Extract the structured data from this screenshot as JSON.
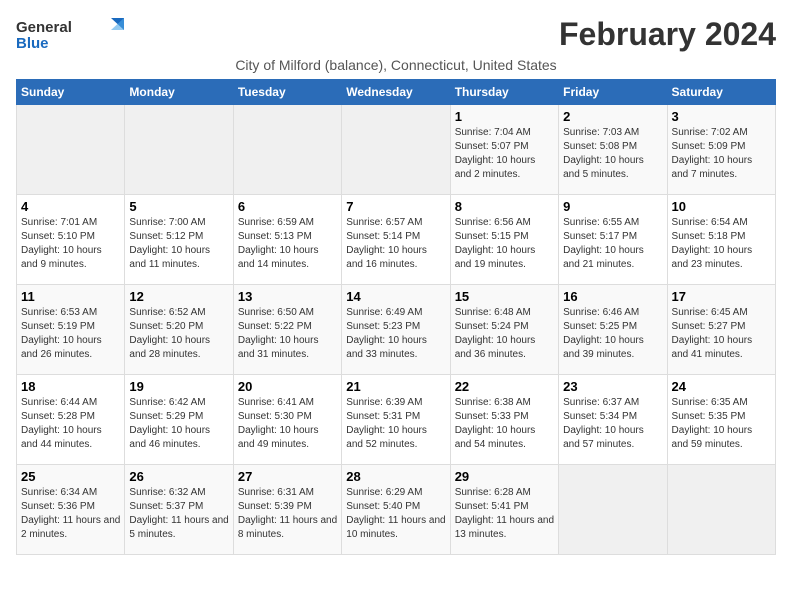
{
  "logo": {
    "general": "General",
    "blue": "Blue"
  },
  "title": "February 2024",
  "subtitle": "City of Milford (balance), Connecticut, United States",
  "days_of_week": [
    "Sunday",
    "Monday",
    "Tuesday",
    "Wednesday",
    "Thursday",
    "Friday",
    "Saturday"
  ],
  "weeks": [
    [
      {
        "day": "",
        "info": ""
      },
      {
        "day": "",
        "info": ""
      },
      {
        "day": "",
        "info": ""
      },
      {
        "day": "",
        "info": ""
      },
      {
        "day": "1",
        "info": "Sunrise: 7:04 AM\nSunset: 5:07 PM\nDaylight: 10 hours\nand 2 minutes."
      },
      {
        "day": "2",
        "info": "Sunrise: 7:03 AM\nSunset: 5:08 PM\nDaylight: 10 hours\nand 5 minutes."
      },
      {
        "day": "3",
        "info": "Sunrise: 7:02 AM\nSunset: 5:09 PM\nDaylight: 10 hours\nand 7 minutes."
      }
    ],
    [
      {
        "day": "4",
        "info": "Sunrise: 7:01 AM\nSunset: 5:10 PM\nDaylight: 10 hours\nand 9 minutes."
      },
      {
        "day": "5",
        "info": "Sunrise: 7:00 AM\nSunset: 5:12 PM\nDaylight: 10 hours\nand 11 minutes."
      },
      {
        "day": "6",
        "info": "Sunrise: 6:59 AM\nSunset: 5:13 PM\nDaylight: 10 hours\nand 14 minutes."
      },
      {
        "day": "7",
        "info": "Sunrise: 6:57 AM\nSunset: 5:14 PM\nDaylight: 10 hours\nand 16 minutes."
      },
      {
        "day": "8",
        "info": "Sunrise: 6:56 AM\nSunset: 5:15 PM\nDaylight: 10 hours\nand 19 minutes."
      },
      {
        "day": "9",
        "info": "Sunrise: 6:55 AM\nSunset: 5:17 PM\nDaylight: 10 hours\nand 21 minutes."
      },
      {
        "day": "10",
        "info": "Sunrise: 6:54 AM\nSunset: 5:18 PM\nDaylight: 10 hours\nand 23 minutes."
      }
    ],
    [
      {
        "day": "11",
        "info": "Sunrise: 6:53 AM\nSunset: 5:19 PM\nDaylight: 10 hours\nand 26 minutes."
      },
      {
        "day": "12",
        "info": "Sunrise: 6:52 AM\nSunset: 5:20 PM\nDaylight: 10 hours\nand 28 minutes."
      },
      {
        "day": "13",
        "info": "Sunrise: 6:50 AM\nSunset: 5:22 PM\nDaylight: 10 hours\nand 31 minutes."
      },
      {
        "day": "14",
        "info": "Sunrise: 6:49 AM\nSunset: 5:23 PM\nDaylight: 10 hours\nand 33 minutes."
      },
      {
        "day": "15",
        "info": "Sunrise: 6:48 AM\nSunset: 5:24 PM\nDaylight: 10 hours\nand 36 minutes."
      },
      {
        "day": "16",
        "info": "Sunrise: 6:46 AM\nSunset: 5:25 PM\nDaylight: 10 hours\nand 39 minutes."
      },
      {
        "day": "17",
        "info": "Sunrise: 6:45 AM\nSunset: 5:27 PM\nDaylight: 10 hours\nand 41 minutes."
      }
    ],
    [
      {
        "day": "18",
        "info": "Sunrise: 6:44 AM\nSunset: 5:28 PM\nDaylight: 10 hours\nand 44 minutes."
      },
      {
        "day": "19",
        "info": "Sunrise: 6:42 AM\nSunset: 5:29 PM\nDaylight: 10 hours\nand 46 minutes."
      },
      {
        "day": "20",
        "info": "Sunrise: 6:41 AM\nSunset: 5:30 PM\nDaylight: 10 hours\nand 49 minutes."
      },
      {
        "day": "21",
        "info": "Sunrise: 6:39 AM\nSunset: 5:31 PM\nDaylight: 10 hours\nand 52 minutes."
      },
      {
        "day": "22",
        "info": "Sunrise: 6:38 AM\nSunset: 5:33 PM\nDaylight: 10 hours\nand 54 minutes."
      },
      {
        "day": "23",
        "info": "Sunrise: 6:37 AM\nSunset: 5:34 PM\nDaylight: 10 hours\nand 57 minutes."
      },
      {
        "day": "24",
        "info": "Sunrise: 6:35 AM\nSunset: 5:35 PM\nDaylight: 10 hours\nand 59 minutes."
      }
    ],
    [
      {
        "day": "25",
        "info": "Sunrise: 6:34 AM\nSunset: 5:36 PM\nDaylight: 11 hours\nand 2 minutes."
      },
      {
        "day": "26",
        "info": "Sunrise: 6:32 AM\nSunset: 5:37 PM\nDaylight: 11 hours\nand 5 minutes."
      },
      {
        "day": "27",
        "info": "Sunrise: 6:31 AM\nSunset: 5:39 PM\nDaylight: 11 hours\nand 8 minutes."
      },
      {
        "day": "28",
        "info": "Sunrise: 6:29 AM\nSunset: 5:40 PM\nDaylight: 11 hours\nand 10 minutes."
      },
      {
        "day": "29",
        "info": "Sunrise: 6:28 AM\nSunset: 5:41 PM\nDaylight: 11 hours\nand 13 minutes."
      },
      {
        "day": "",
        "info": ""
      },
      {
        "day": "",
        "info": ""
      }
    ]
  ]
}
